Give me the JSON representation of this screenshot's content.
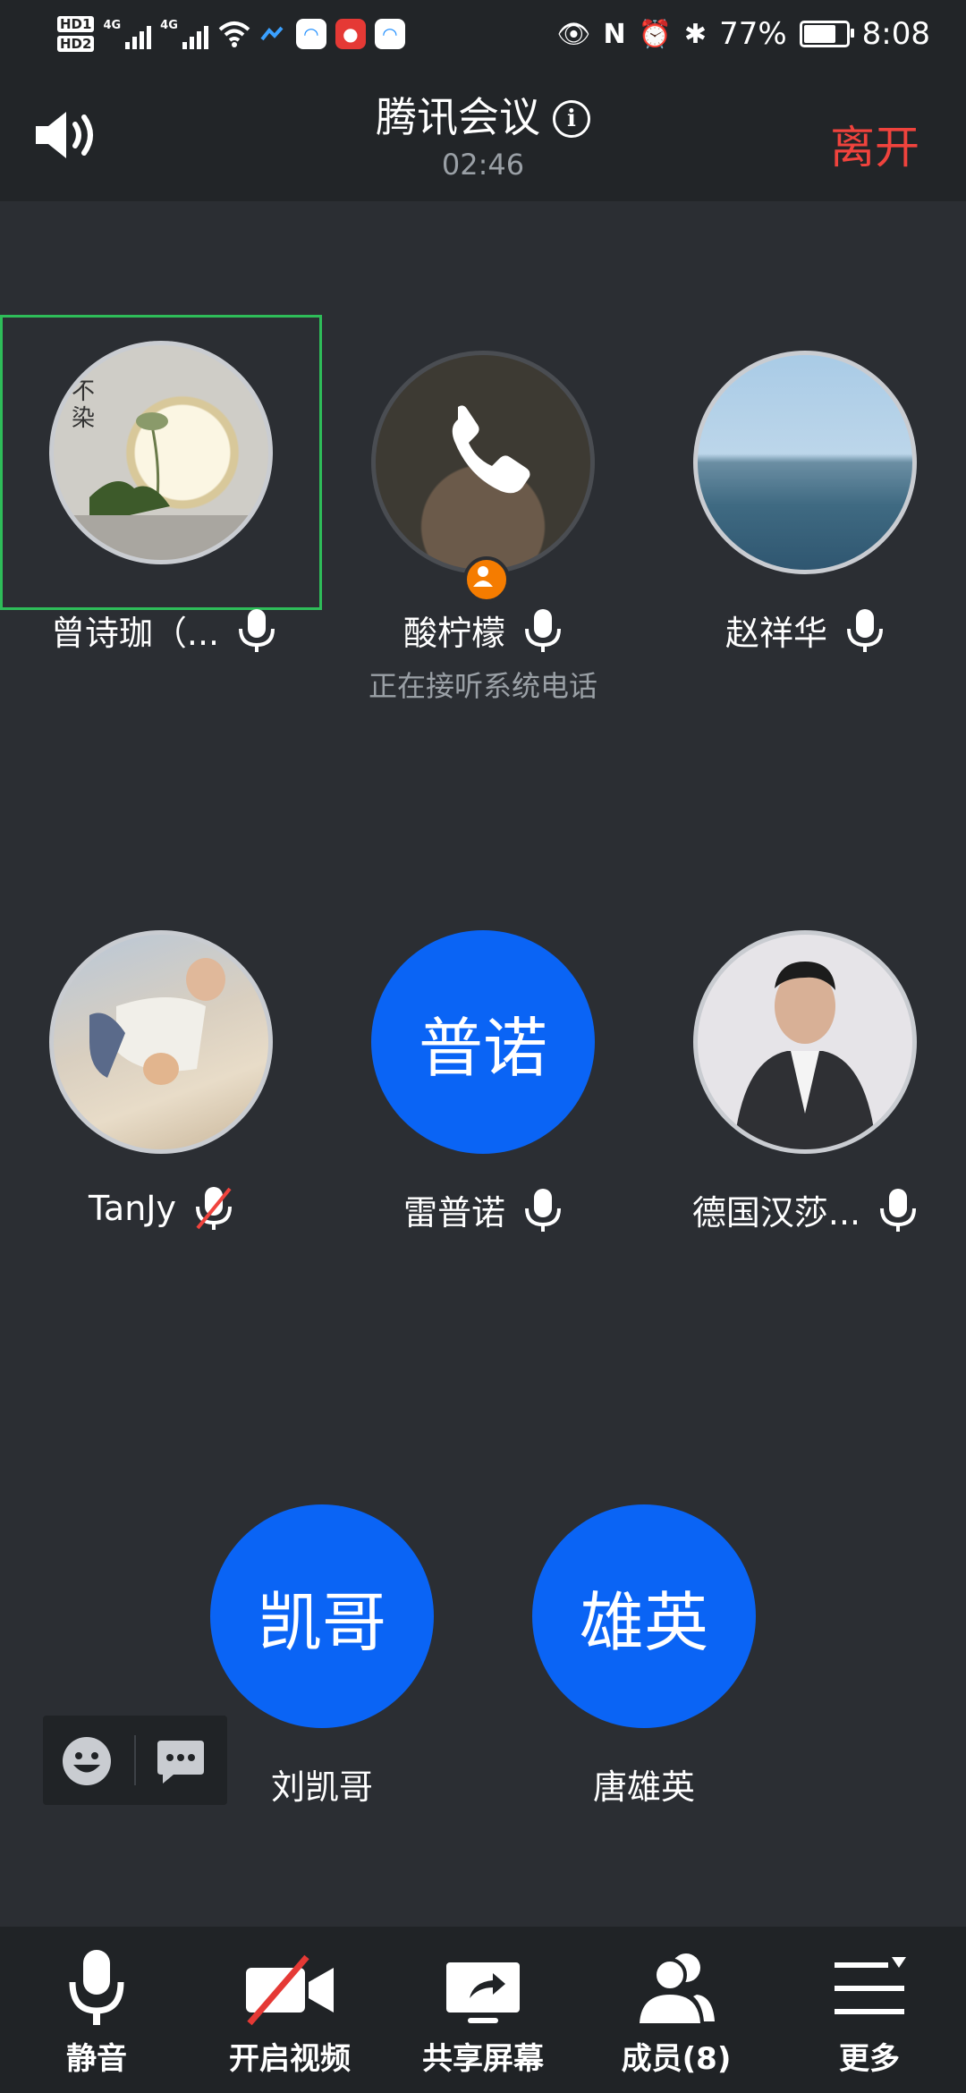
{
  "status_bar": {
    "hd1": "HD",
    "hd2": "HD",
    "hd1_sub": "1",
    "hd2_sub": "2",
    "net1": "4G",
    "net2": "4G",
    "battery": "77%",
    "time": "8:08"
  },
  "header": {
    "title": "腾讯会议",
    "timer": "02:46",
    "leave_label": "离开"
  },
  "participants": [
    {
      "name": "曾诗珈（...",
      "avatar_type": "photo",
      "mic": "on",
      "speaking": true
    },
    {
      "name": "酸柠檬",
      "avatar_type": "photo",
      "mic": "on",
      "subtext": "正在接听系统电话"
    },
    {
      "name": "赵祥华",
      "avatar_type": "photo",
      "mic": "on"
    },
    {
      "name": "TanJy",
      "avatar_type": "photo",
      "mic": "muted"
    },
    {
      "name": "雷普诺",
      "avatar_type": "initials",
      "initials": "普诺",
      "mic": "on"
    },
    {
      "name": "德国汉莎...",
      "avatar_type": "photo",
      "mic": "on"
    },
    {
      "name": "刘凯哥",
      "avatar_type": "initials",
      "initials": "凯哥"
    },
    {
      "name": "唐雄英",
      "avatar_type": "initials",
      "initials": "雄英"
    }
  ],
  "toolbar": {
    "mute_label": "静音",
    "video_label": "开启视频",
    "share_label": "共享屏幕",
    "members_label": "成员(8)",
    "more_label": "更多"
  },
  "colors": {
    "accent_blue": "#0a64f5",
    "leave_red": "#f0433d",
    "speaking_border": "#2ebd59",
    "background": "#2b2e33"
  }
}
